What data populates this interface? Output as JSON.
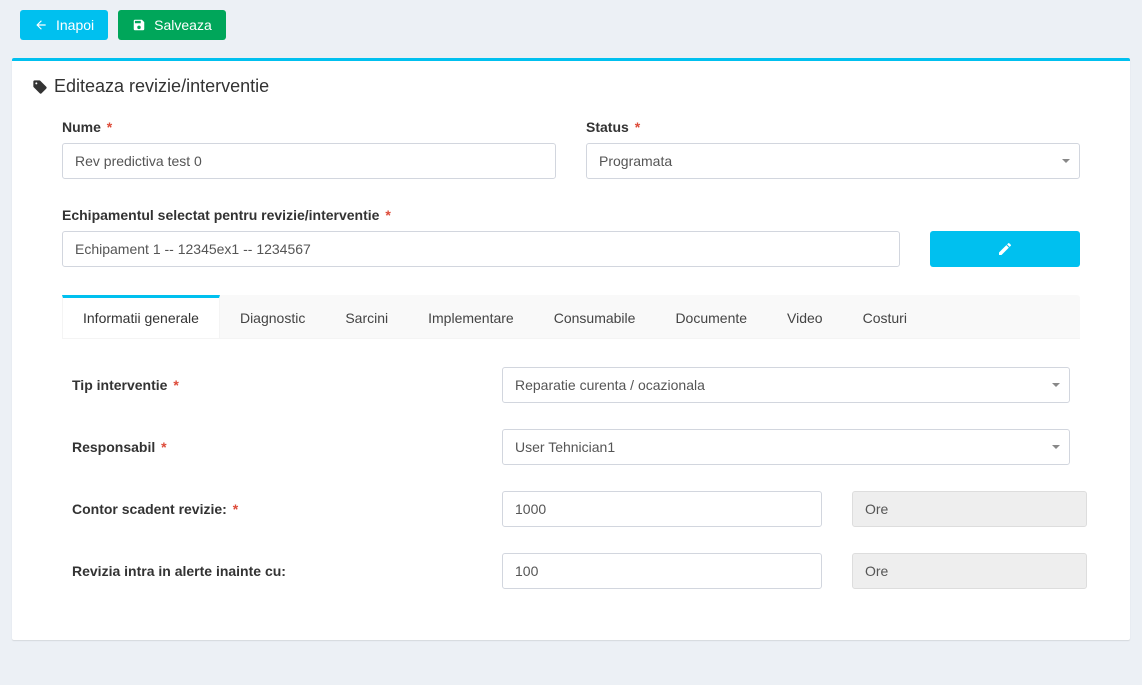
{
  "actions": {
    "back_label": "Inapoi",
    "save_label": "Salveaza"
  },
  "page": {
    "title": "Editeaza revizie/interventie"
  },
  "form": {
    "name_label": "Nume",
    "name_value": "Rev predictiva test 0",
    "status_label": "Status",
    "status_value": "Programata",
    "equipment_label": "Echipamentul selectat pentru revizie/interventie",
    "equipment_value": "Echipament 1 -- 12345ex1 -- 1234567"
  },
  "tabs": [
    {
      "label": "Informatii generale",
      "active": true
    },
    {
      "label": "Diagnostic",
      "active": false
    },
    {
      "label": "Sarcini",
      "active": false
    },
    {
      "label": "Implementare",
      "active": false
    },
    {
      "label": "Consumabile",
      "active": false
    },
    {
      "label": "Documente",
      "active": false
    },
    {
      "label": "Video",
      "active": false
    },
    {
      "label": "Costuri",
      "active": false
    }
  ],
  "general": {
    "type_label": "Tip interventie",
    "type_value": "Reparatie curenta / ocazionala",
    "responsible_label": "Responsabil",
    "responsible_value": "User Tehnician1",
    "counter_label": "Contor scadent revizie:",
    "counter_value": "1000",
    "counter_unit": "Ore",
    "alert_label": "Revizia intra in alerte inainte cu:",
    "alert_value": "100",
    "alert_unit": "Ore"
  },
  "required_mark": "*"
}
